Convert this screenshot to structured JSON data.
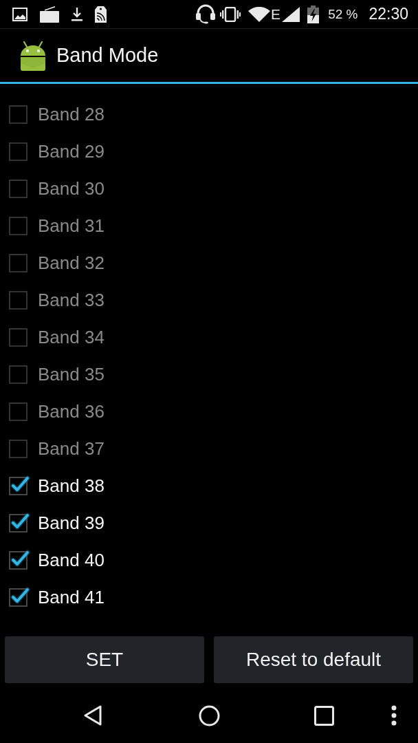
{
  "status_bar": {
    "network_type": "E",
    "battery_text": "52 %",
    "time": "22:30"
  },
  "action_bar": {
    "title": "Band Mode"
  },
  "bands": [
    {
      "label": "Band 28",
      "checked": false,
      "disabled": true
    },
    {
      "label": "Band 29",
      "checked": false,
      "disabled": true
    },
    {
      "label": "Band 30",
      "checked": false,
      "disabled": true
    },
    {
      "label": "Band 31",
      "checked": false,
      "disabled": true
    },
    {
      "label": "Band 32",
      "checked": false,
      "disabled": true
    },
    {
      "label": "Band 33",
      "checked": false,
      "disabled": true
    },
    {
      "label": "Band 34",
      "checked": false,
      "disabled": true
    },
    {
      "label": "Band 35",
      "checked": false,
      "disabled": true
    },
    {
      "label": "Band 36",
      "checked": false,
      "disabled": true
    },
    {
      "label": "Band 37",
      "checked": false,
      "disabled": true
    },
    {
      "label": "Band 38",
      "checked": true,
      "disabled": false
    },
    {
      "label": "Band 39",
      "checked": true,
      "disabled": false
    },
    {
      "label": "Band 40",
      "checked": true,
      "disabled": false
    },
    {
      "label": "Band 41",
      "checked": true,
      "disabled": false
    }
  ],
  "buttons": [
    {
      "label": "SET"
    },
    {
      "label": "Reset to default"
    }
  ]
}
